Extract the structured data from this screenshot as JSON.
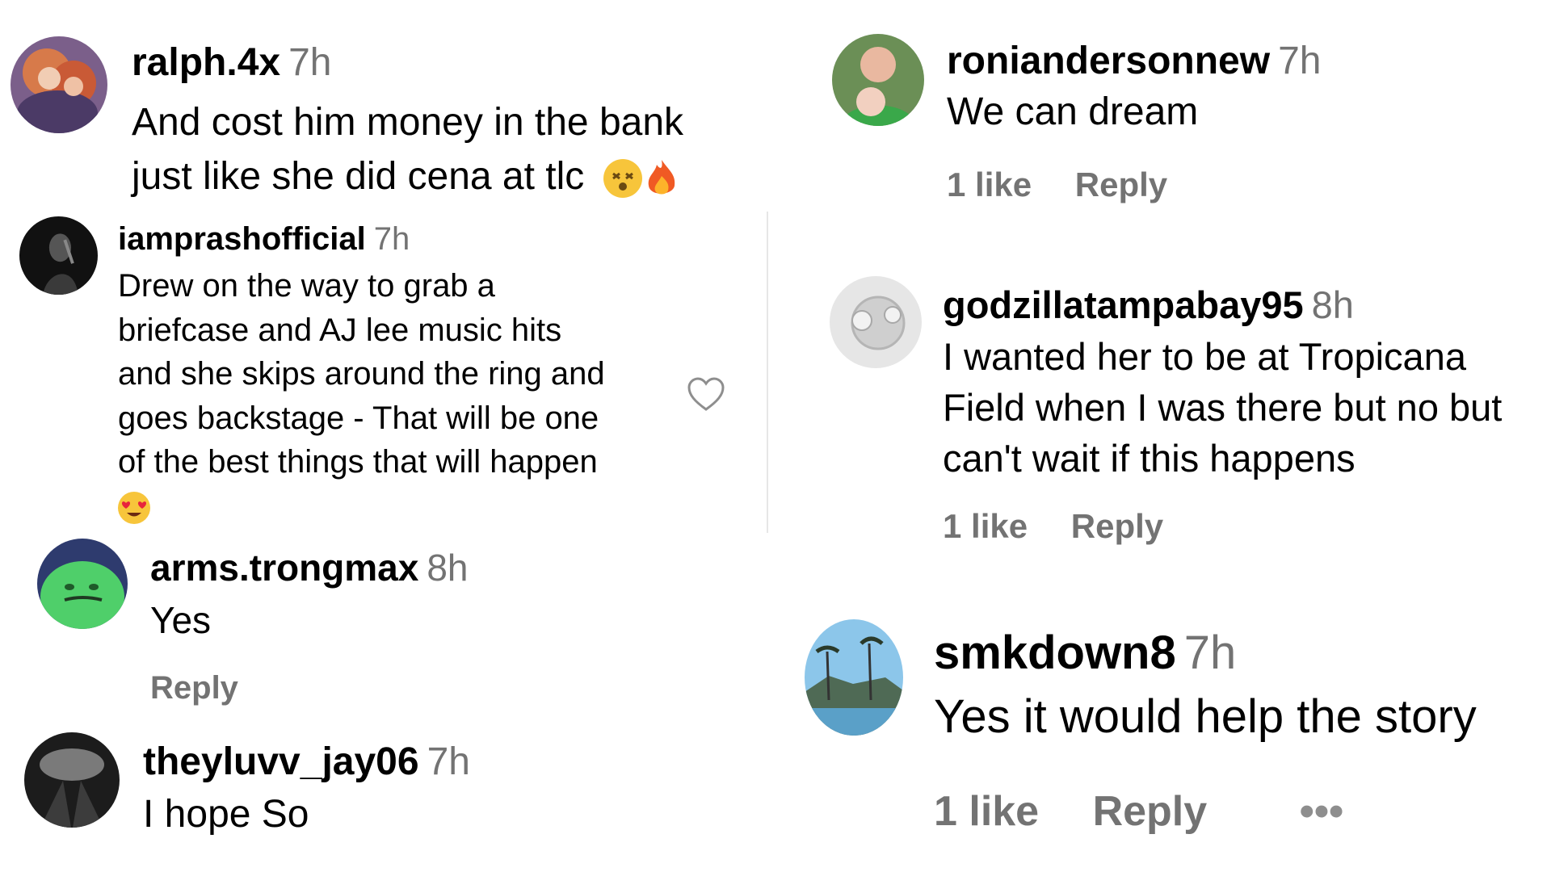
{
  "colors": {
    "username": "#000000",
    "meta": "#737373",
    "divider": "#e6e6e6"
  },
  "comments": [
    {
      "username": "ralph.4x",
      "time": "7h",
      "lines": [
        "And cost him money in the bank",
        "just like she did cena at tlc"
      ],
      "emojis": [
        "dizzy-face-emoji",
        "fire-emoji"
      ]
    },
    {
      "username": "iamprashofficial",
      "time": "7h",
      "lines": [
        "Drew on the way to grab a",
        "briefcase and AJ lee music hits",
        "and she skips around the ring and",
        "goes backstage - That will be one",
        "of the best things that will happen"
      ],
      "emojis": [
        "heart-eyes-emoji"
      ],
      "icon": "heart-outline-icon"
    },
    {
      "username": "arms.trongmax",
      "time": "8h",
      "lines": [
        "Yes"
      ],
      "reply_label": "Reply"
    },
    {
      "username": "theyluvv_jay06",
      "time": "7h",
      "lines": [
        "I hope So"
      ]
    },
    {
      "username": "ronianderson​new",
      "time": "7h",
      "lines": [
        "We can dream"
      ],
      "likes_label": "1 like",
      "reply_label": "Reply"
    },
    {
      "username": "godzillatampabay95",
      "time": "8h",
      "lines": [
        "I wanted her to be at Tropicana",
        "Field when I was there but no but",
        "can't wait if this happens"
      ],
      "likes_label": "1 like",
      "reply_label": "Reply"
    },
    {
      "username": "smkdown8",
      "time": "7h",
      "lines": [
        "Yes it would help the story"
      ],
      "likes_label": "1 like",
      "reply_label": "Reply",
      "more_label": "•••"
    }
  ]
}
